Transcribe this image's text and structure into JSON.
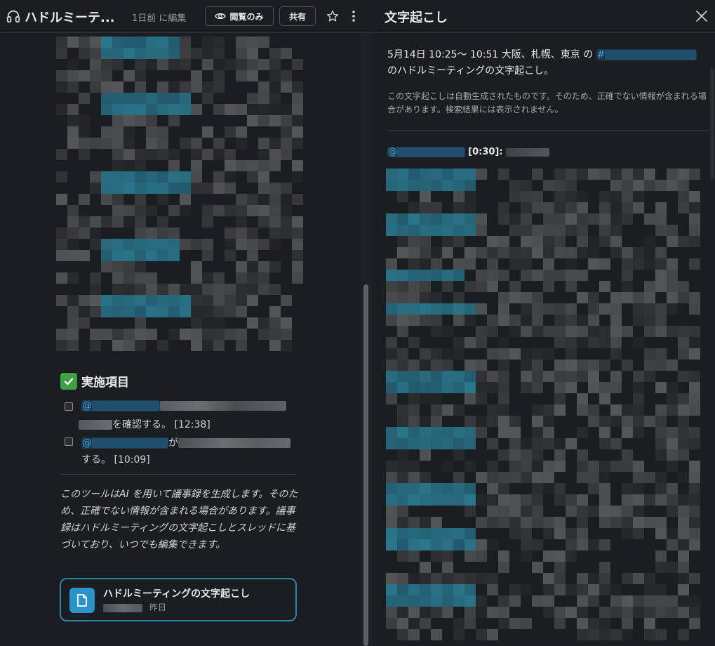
{
  "left_header": {
    "title": "ハドルミーテ...",
    "edited": "1日前 に編集",
    "view_only_label": "閲覧のみ",
    "share_label": "共有"
  },
  "action_items": {
    "heading": "実施項目",
    "items": [
      {
        "mention": "@",
        "suffix": "を確認する。 [12:38]"
      },
      {
        "mention": "@",
        "connector": "が",
        "suffix": "する。 [10:09]"
      }
    ]
  },
  "disclaimer": "このツールはAI を用いて議事録を生成します。そのため、正確でない情報が含まれる場合があります。議事録はハドルミーティングの文字起こしとスレッドに基づいており、いつでも編集できます。",
  "transcript_card": {
    "title": "ハドルミーティングの文字起こし",
    "time": "昨日"
  },
  "right_panel": {
    "title": "文字起こし",
    "info_prefix": "5月14日 10:25〜 10:51 大阪、札幌、東京 の",
    "channel_hash": "#",
    "info_suffix": "のハドルミーティングの文字起こし。",
    "note": "この文字起こしは自動生成されたものです。そのため、正確でない情報が含まれる場合があります。検索結果には表示されません。",
    "first_speaker_mention": "@",
    "first_timestamp": "[0:30]:"
  },
  "colors": {
    "background": "#1a1d21",
    "mention_blue": "#3aa3e3",
    "card_border": "#2b86a8",
    "doc_icon_bg": "#2b93c9",
    "check_green": "#3fa044"
  }
}
